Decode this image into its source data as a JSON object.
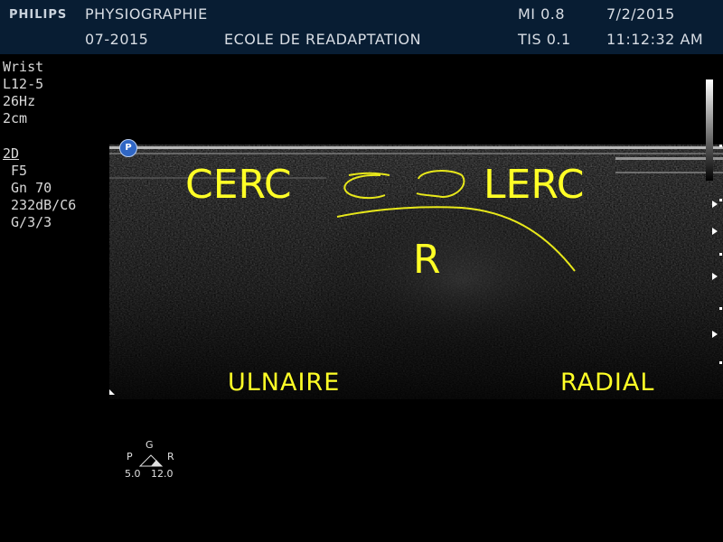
{
  "header": {
    "brand": "PHILIPS",
    "institution": "PHYSIOGRAPHIE",
    "exam_id": "07-2015",
    "facility": "ECOLE DE READAPTATION",
    "mi": "MI 0.8",
    "tis": "TIS 0.1",
    "date": "7/2/2015",
    "time": "11:12:32 AM"
  },
  "params": {
    "preset": "Wrist",
    "probe": "L12-5",
    "frame_rate": "26Hz",
    "depth": "2cm",
    "mode": "2D",
    "focus": " F5",
    "gain": " Gn 70",
    "dynamic_range": " 232dB/C6",
    "map": " G/3/3"
  },
  "annotations": {
    "cerc": "CERC",
    "lerc": "LERC",
    "r": "R",
    "ulnaire": "ULNAIRE",
    "radial": "RADIAL"
  },
  "icons": {
    "probe_orientation": "P"
  },
  "legend": {
    "g": "G",
    "p": "P",
    "r": "R",
    "p_value": "5.0",
    "r_value": "12.0"
  },
  "colors": {
    "annotation": "#ffff26",
    "header_bg": "#081d33"
  }
}
